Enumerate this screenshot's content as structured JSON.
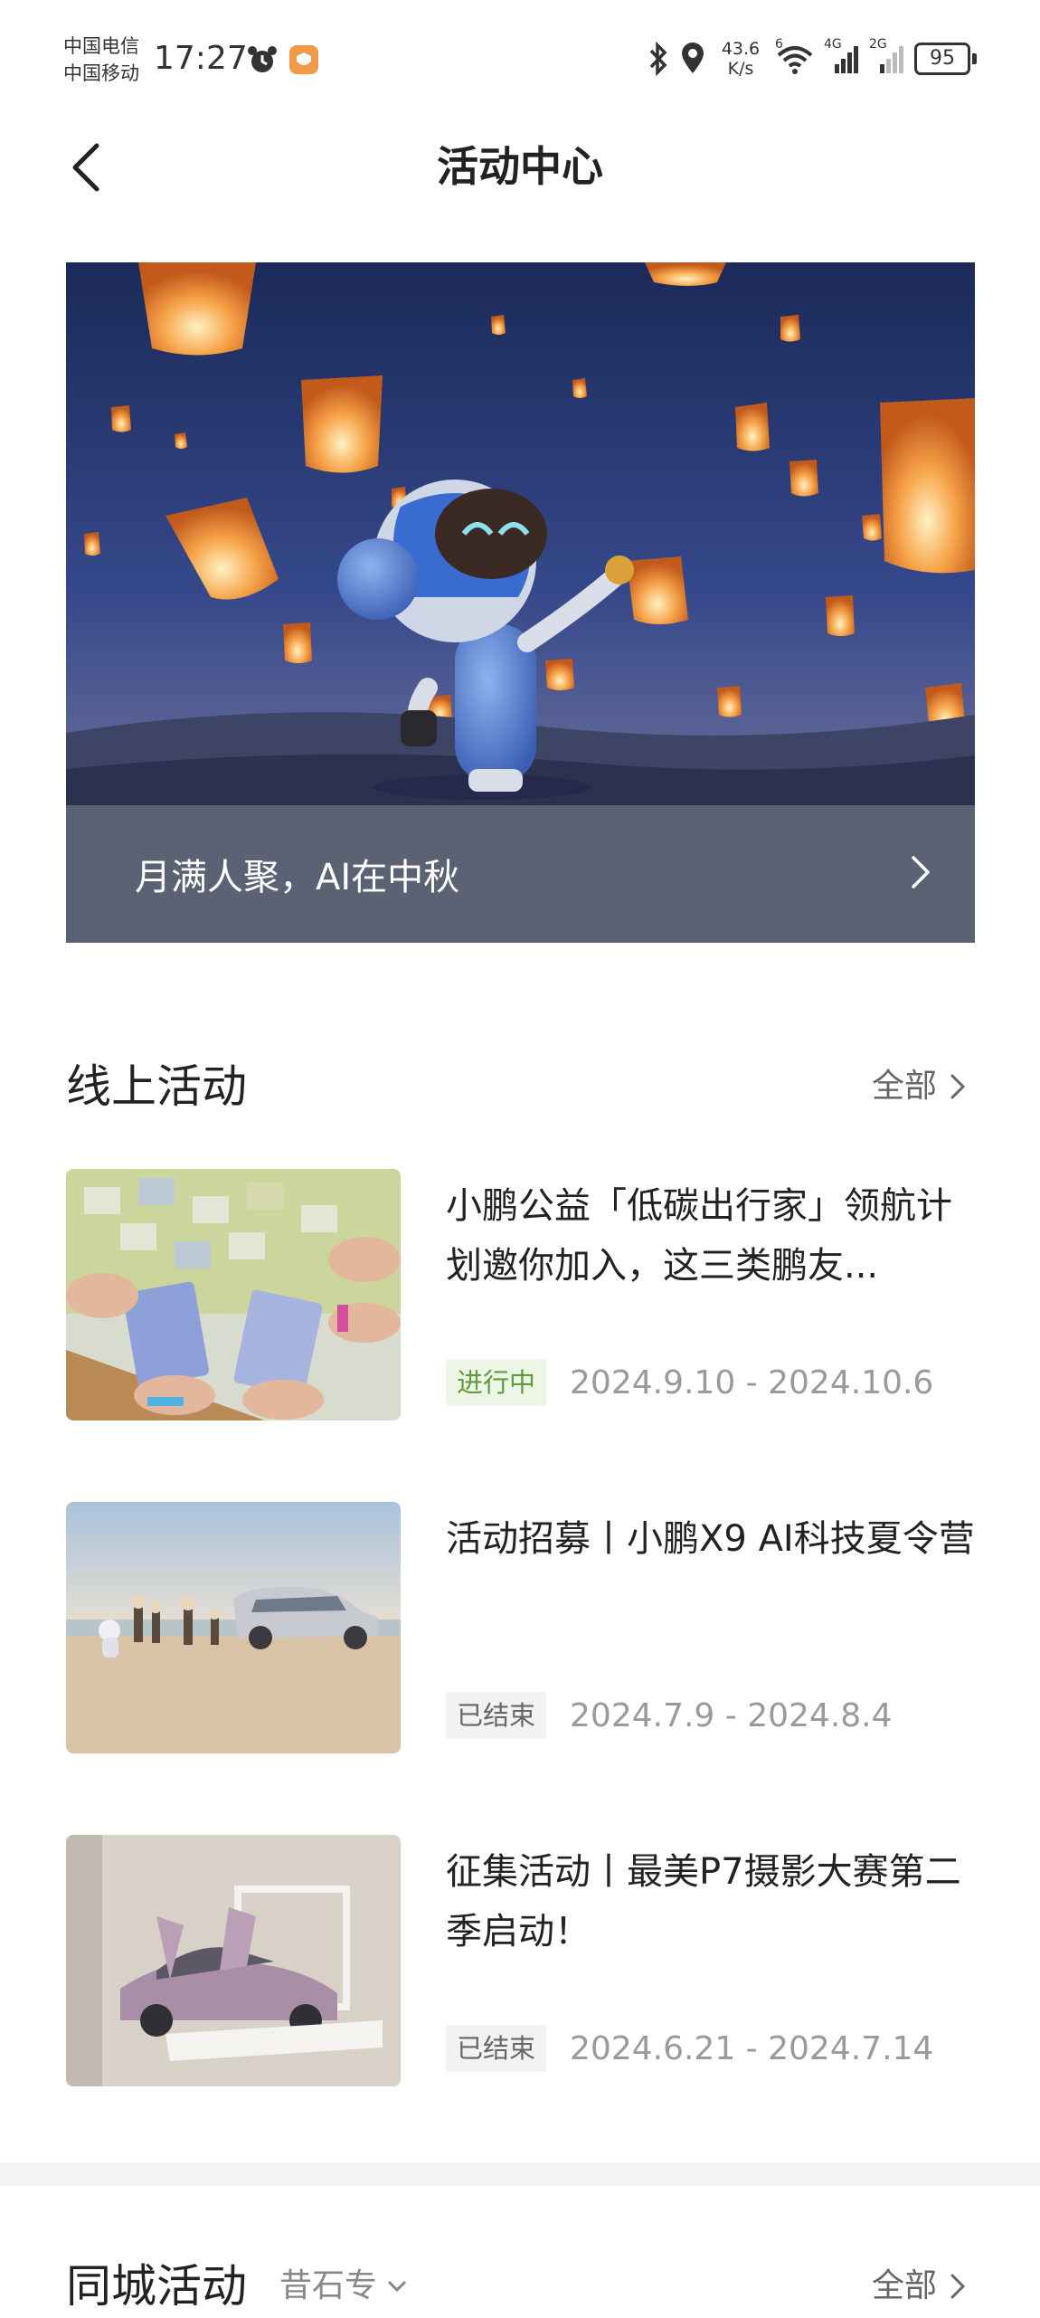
{
  "status_bar": {
    "carrier_1": "中国电信",
    "carrier_2": "中国移动",
    "time": "17:27",
    "net_speed_value": "43.6",
    "net_speed_unit": "K/s",
    "wifi_label": "6",
    "signal_1_label": "4G",
    "signal_2_label": "2G",
    "battery": "95",
    "icons": [
      "alarm-icon",
      "app-badge-icon",
      "bluetooth-icon",
      "location-icon",
      "wifi-icon",
      "signal-icon",
      "battery-icon"
    ]
  },
  "header": {
    "title": "活动中心",
    "back_icon": "chevron-left-icon"
  },
  "banner": {
    "title": "月满人聚，AI在中秋",
    "chevron_icon": "chevron-right-icon"
  },
  "online_section": {
    "title": "线上活动",
    "all_label": "全部",
    "activities": [
      {
        "title": "小鹏公益「低碳出行家」领航计划邀你加入，这三类鹏友...",
        "status": "进行中",
        "status_type": "ongoing",
        "date_range": "2024.9.10 - 2024.10.6"
      },
      {
        "title": "活动招募丨小鹏X9 AI科技夏令营",
        "status": "已结束",
        "status_type": "ended",
        "date_range": "2024.7.9 - 2024.8.4"
      },
      {
        "title": "征集活动丨最美P7摄影大赛第二季启动！",
        "status": "已结束",
        "status_type": "ended",
        "date_range": "2024.6.21 - 2024.7.14"
      }
    ]
  },
  "city_section": {
    "title": "同城活动",
    "city_label": "昔石专",
    "all_label": "全部"
  },
  "colors": {
    "ongoing_tag_bg": "#edf6e6",
    "ongoing_tag_text": "#5f9a3c",
    "ended_tag_bg": "#f2f2f2",
    "banner_bar": "#5b6274"
  }
}
